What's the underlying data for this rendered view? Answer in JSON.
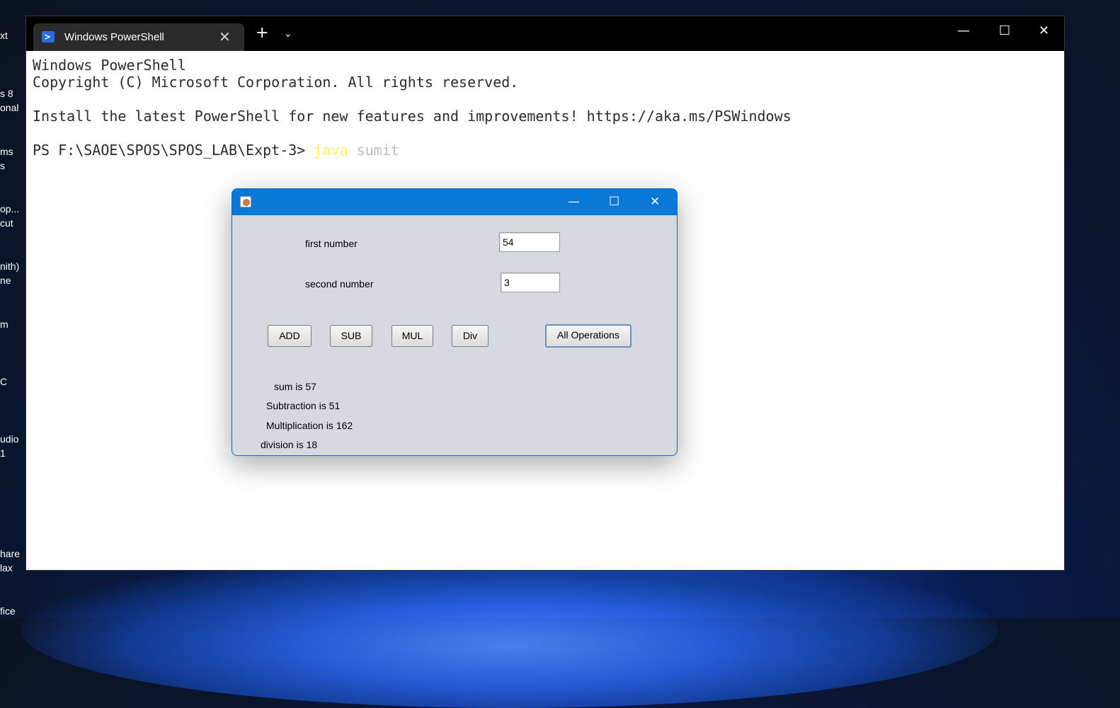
{
  "desktop": {
    "labels": [
      "xt",
      "s 8\nonal",
      "ms\ns",
      "op...\ncut",
      "nith)\nne",
      "m",
      "C",
      "udio\n1",
      "hare\nlax",
      "fice"
    ]
  },
  "terminal": {
    "tab_title": "Windows PowerShell",
    "tab_icon": "powershell-icon",
    "lines": [
      "Windows PowerShell",
      "Copyright (C) Microsoft Corporation. All rights reserved.",
      "",
      "Install the latest PowerShell for new features and improvements! https://aka.ms/PSWindows",
      ""
    ],
    "prompt": "PS F:\\SAOE\\SPOS\\SPOS_LAB\\Expt-3> ",
    "command": "java",
    "argument": "sumit"
  },
  "java_app": {
    "first_label": "first number",
    "first_value": "54",
    "second_label": "second number",
    "second_value": "3",
    "buttons": {
      "add": "ADD",
      "sub": "SUB",
      "mul": "MUL",
      "div": "Div",
      "all": "All Operations"
    },
    "results": {
      "sum": "sum is 57",
      "sub": "Subtraction is 51",
      "mul": "Multiplication is 162",
      "div": "division is 18"
    }
  }
}
